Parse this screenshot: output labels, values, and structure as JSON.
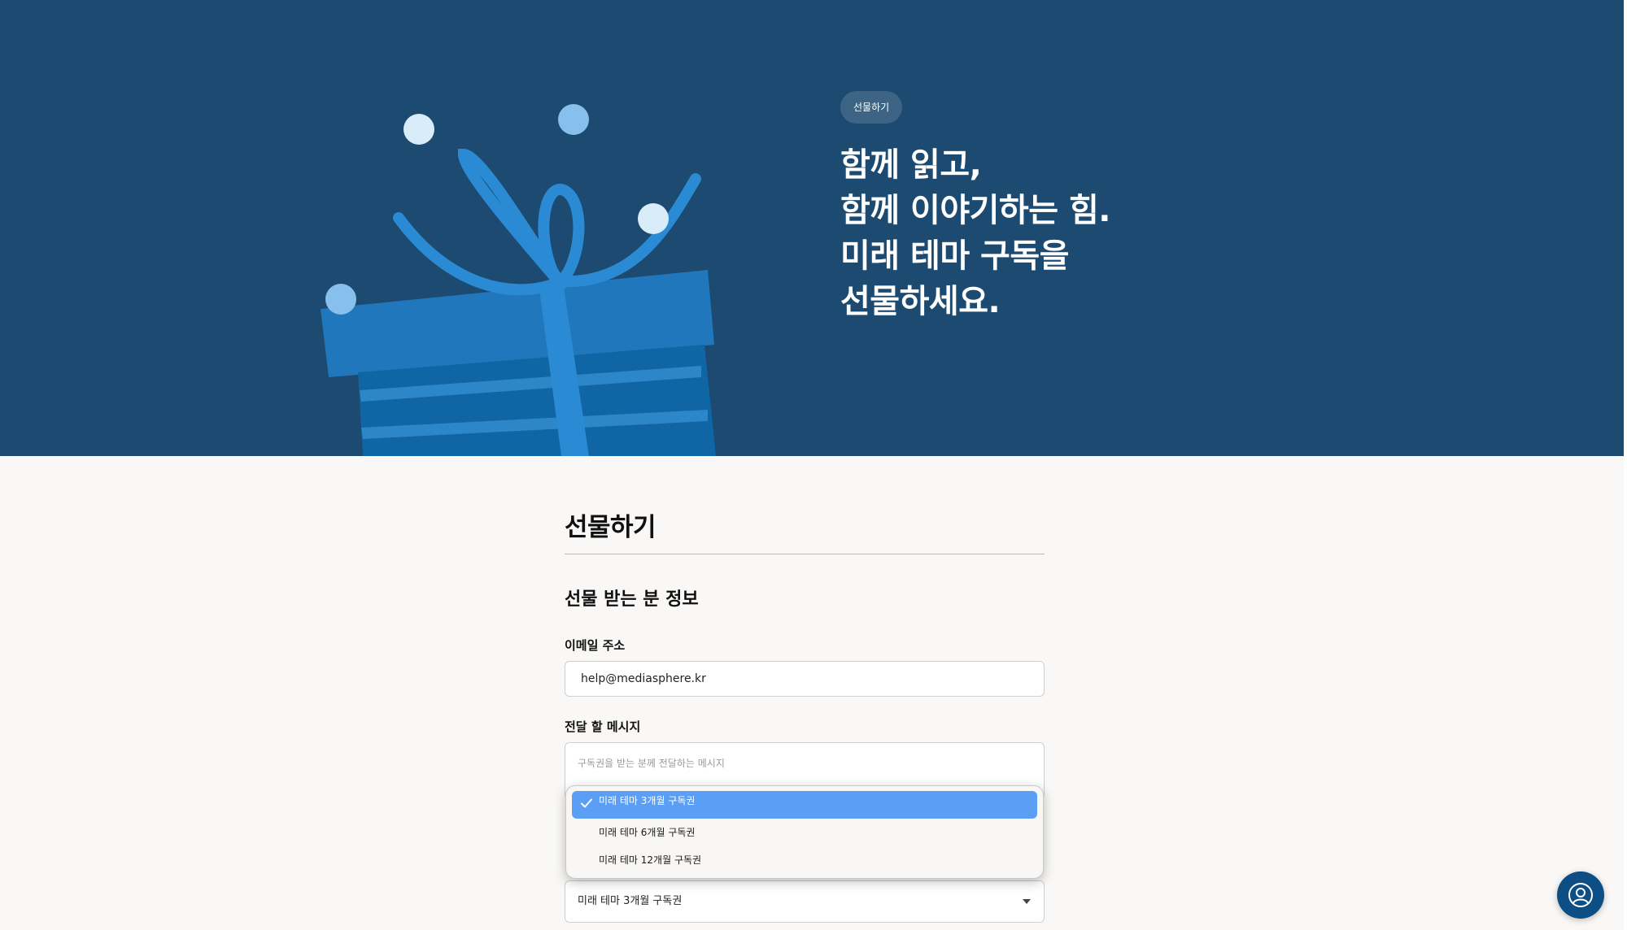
{
  "hero": {
    "badge": "선물하기",
    "headline_lines": [
      "함께 읽고,",
      "함께 이야기하는 힘.",
      "미래 테마 구독을",
      "선물하세요."
    ]
  },
  "form": {
    "title": "선물하기",
    "section_heading": "선물 받는 분 정보",
    "email_label": "이메일 주소",
    "email_value": "help@mediasphere.kr",
    "message_label": "전달 할 메시지",
    "message_placeholder": "구독권을 받는 분께 전달하는 메시지",
    "subscription_select": {
      "selected": "미래 테마 3개월 구독권",
      "options": [
        "미래 테마 3개월 구독권",
        "미래 테마 6개월 구독권",
        "미래 테마 12개월 구독권"
      ]
    }
  },
  "icons": {
    "check": "checkmark-icon",
    "caret": "chevron-down-icon",
    "support": "user-circle-icon",
    "gift": "gift-illustration"
  },
  "colors": {
    "hero_bg": "#1c4a70",
    "page_bg": "#f9f8f6",
    "selected_option": "#5a9ff5",
    "support_button": "#0d4e84"
  }
}
